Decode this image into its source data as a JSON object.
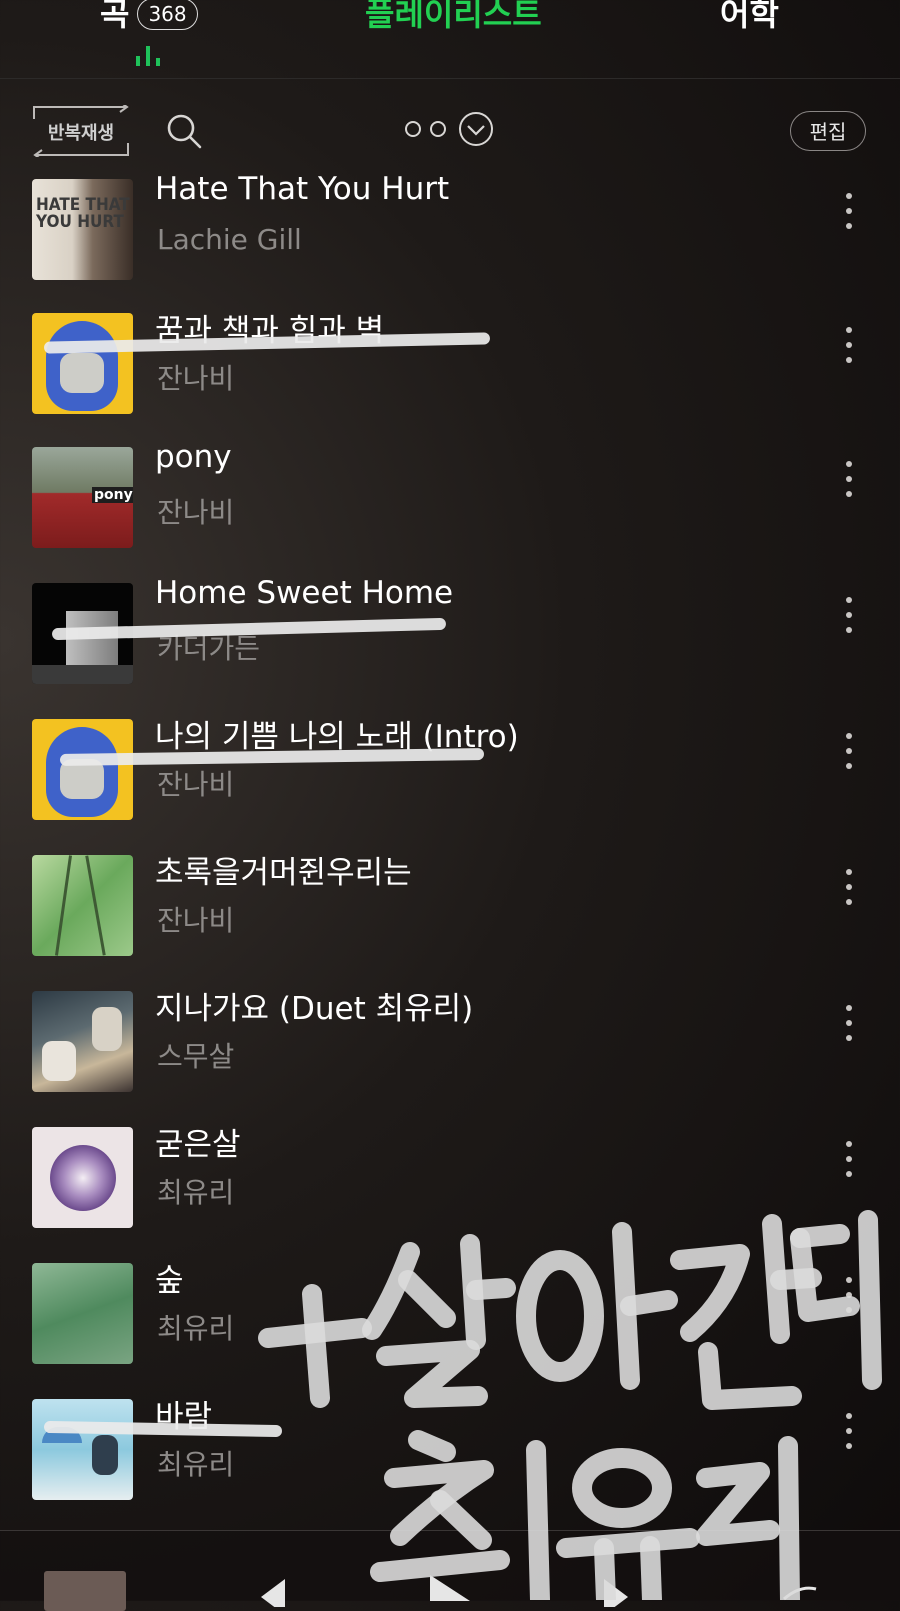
{
  "tabs": {
    "songs_label": "곡",
    "songs_count": "368",
    "playlist_label": "플레이리스트",
    "language_label": "어학",
    "active": "playlist",
    "accent": "#22d052"
  },
  "toolbar": {
    "repeat_label": "반복재생",
    "edit_label": "편집"
  },
  "songs": [
    {
      "title": "Hate That You Hurt",
      "artist": "Lachie Gill",
      "cover_text": "HATE THAT YOU HURT",
      "struck": false
    },
    {
      "title": "꿈과 책과 힘과 벽",
      "artist": "잔나비",
      "struck": true
    },
    {
      "title": "pony",
      "artist": "잔나비",
      "cover_text": "pony",
      "struck": false
    },
    {
      "title": "Home Sweet Home",
      "artist": "카더가든",
      "struck": true
    },
    {
      "title": "나의 기쁨 나의 노래 (Intro)",
      "artist": "잔나비",
      "struck": true
    },
    {
      "title": "초록을거머쥔우리는",
      "artist": "잔나비",
      "struck": false
    },
    {
      "title": "지나가요 (Duet 최유리)",
      "artist": "스무살",
      "struck": false
    },
    {
      "title": "굳은살",
      "artist": "최유리",
      "struck": false
    },
    {
      "title": "숲",
      "artist": "최유리",
      "struck": false
    },
    {
      "title": "바람",
      "artist": "최유리",
      "struck": true
    }
  ],
  "handwritten_note": "+살아간다 최유리"
}
